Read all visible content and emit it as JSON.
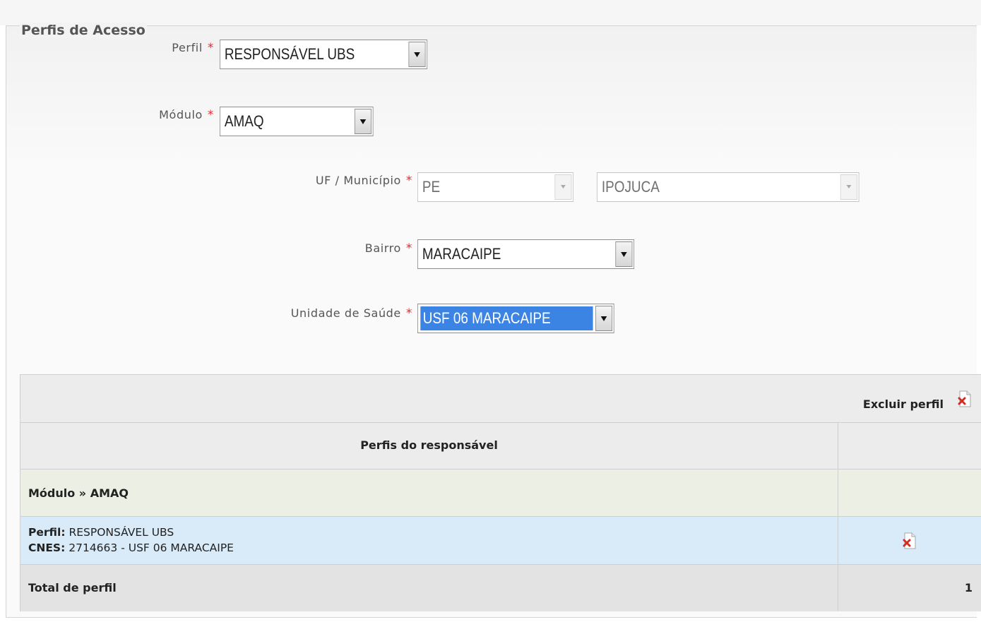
{
  "section": {
    "legend": "Perfis de Acesso"
  },
  "form": {
    "perfil": {
      "label": "Perfil",
      "required": "*",
      "value": "RESPONSÁVEL UBS"
    },
    "modulo": {
      "label": "Módulo",
      "required": "*",
      "value": "AMAQ"
    },
    "uf_municipio": {
      "label": "UF / Município",
      "required": "*",
      "uf_value": "PE",
      "municipio_value": "IPOJUCA"
    },
    "bairro": {
      "label": "Bairro",
      "required": "*",
      "value": "MARACAIPE"
    },
    "unidade_saude": {
      "label": "Unidade de Saúde",
      "required": "*",
      "value": "USF 06 MARACAIPE"
    }
  },
  "table": {
    "excluir_label": "Excluir perfil",
    "header": "Perfis do responsável",
    "module_row": "Módulo » AMAQ",
    "entry": {
      "perfil_label": "Perfil:",
      "perfil_value": " RESPONSÁVEL UBS",
      "cnes_label": "CNES:",
      "cnes_value": " 2714663 - USF 06 MARACAIPE"
    },
    "total_label": "Total de perfil",
    "total_value": "1"
  },
  "icons": {
    "delete": "delete-document-icon"
  },
  "colors": {
    "required_star": "#e8272c",
    "selected_option": "#3b84e4",
    "entry_row_bg": "#d9ebf8",
    "module_row_bg": "#ecefe4"
  }
}
